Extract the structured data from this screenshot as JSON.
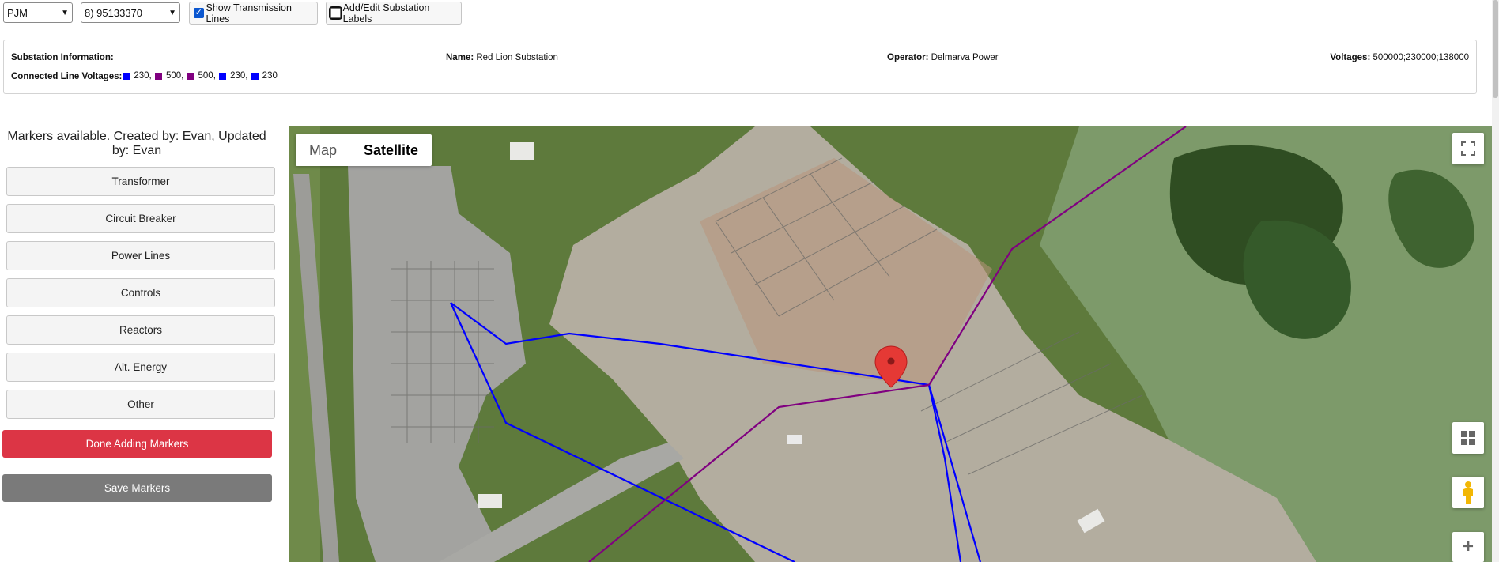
{
  "toolbar": {
    "region_select": "PJM",
    "substation_select": "8) 95133370",
    "show_lines_label": "Show Transmission Lines",
    "show_lines_checked": true,
    "edit_labels_label": "Add/Edit Substation Labels",
    "edit_labels_checked": false
  },
  "info": {
    "section_label": "Substation Information:",
    "name_label": "Name:",
    "name_value": "Red Lion Substation",
    "operator_label": "Operator:",
    "operator_value": "Delmarva Power",
    "voltages_label": "Voltages:",
    "voltages_value": "500000;230000;138000",
    "connected_label": "Connected Line Voltages:",
    "connected": [
      {
        "voltage": "230",
        "color": "#0000ff"
      },
      {
        "voltage": "500",
        "color": "#800080"
      },
      {
        "voltage": "500",
        "color": "#800080"
      },
      {
        "voltage": "230",
        "color": "#0000ff"
      },
      {
        "voltage": "230",
        "color": "#0000ff"
      }
    ]
  },
  "sidebar": {
    "title": "Markers available. Created by: Evan, Updated by: Evan",
    "categories": [
      "Transformer",
      "Circuit Breaker",
      "Power Lines",
      "Controls",
      "Reactors",
      "Alt. Energy",
      "Other"
    ],
    "done_label": "Done Adding Markers",
    "save_label": "Save Markers"
  },
  "map": {
    "type_map": "Map",
    "type_satellite": "Satellite",
    "active_type": "Satellite",
    "controls": [
      "fullscreen-icon",
      "layers-icon",
      "pegman-icon",
      "zoom-in-icon"
    ],
    "line_colors": {
      "kv230": "#0000ff",
      "kv500": "#800080"
    },
    "marker_color": "#e53935"
  }
}
